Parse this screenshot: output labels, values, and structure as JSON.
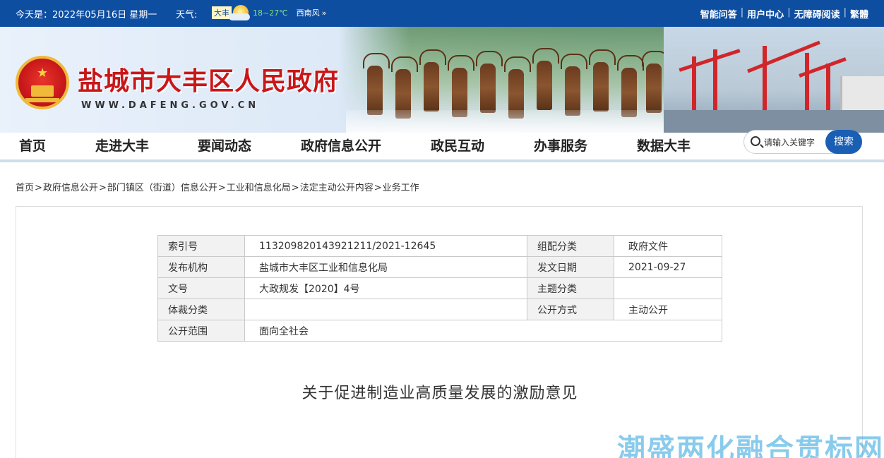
{
  "topbar": {
    "date": "今天是：2022年05月16日 星期一",
    "weather_label": "天气:",
    "weather_city": "大丰",
    "weather_icon": "partly-cloudy-icon",
    "weather_temp": "18~27℃",
    "weather_wind": "西南风",
    "links": [
      "智能问答",
      "用户中心",
      "无障碍阅读",
      "繁體"
    ],
    "sep": "|"
  },
  "header": {
    "title": "盐城市大丰区人民政府",
    "url": "WWW.DAFENG.GOV.CN"
  },
  "nav": {
    "items": [
      "首页",
      "走进大丰",
      "要闻动态",
      "政府信息公开",
      "政民互动",
      "办事服务",
      "数据大丰"
    ]
  },
  "search": {
    "placeholder": "请输入关键字",
    "button": "搜索"
  },
  "breadcrumb": [
    "首页",
    "政府信息公开",
    "部门镇区（街道）信息公开",
    "工业和信息化局",
    "法定主动公开内容",
    "业务工作"
  ],
  "breadcrumb_sep": ">",
  "meta": {
    "rows": [
      {
        "k1": "索引号",
        "v1": "113209820143921211/2021-12645",
        "k2": "组配分类",
        "v2": "政府文件"
      },
      {
        "k1": "发布机构",
        "v1": "盐城市大丰区工业和信息化局",
        "k2": "发文日期",
        "v2": "2021-09-27"
      },
      {
        "k1": "文号",
        "v1": "大政规发【2020】4号",
        "k2": "主题分类",
        "v2": ""
      },
      {
        "k1": "体裁分类",
        "v1": "",
        "k2": "公开方式",
        "v2": "主动公开"
      },
      {
        "k1": "公开范围",
        "v1": "面向全社会"
      }
    ]
  },
  "document": {
    "title": "关于促进制造业高质量发展的激励意见"
  },
  "watermark": "潮盛两化融合贯标网",
  "colors": {
    "topbar_bg": "#0e4ea1",
    "title_red": "#c8171a",
    "search_button": "#1a5fb4"
  }
}
